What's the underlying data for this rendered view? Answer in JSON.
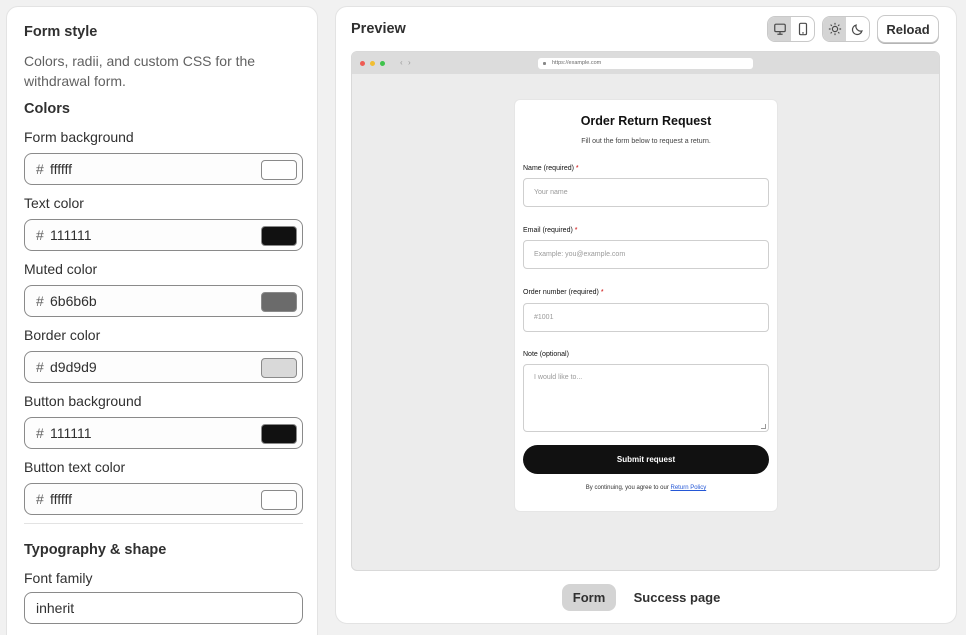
{
  "sidebar": {
    "title": "Form style",
    "description": "Colors, radii, and custom CSS for the withdrawal form.",
    "colors_heading": "Colors",
    "hash": "#",
    "fields": [
      {
        "label": "Form background",
        "value": "ffffff",
        "swatch": "#ffffff"
      },
      {
        "label": "Text color",
        "value": "111111",
        "swatch": "#111111"
      },
      {
        "label": "Muted color",
        "value": "6b6b6b",
        "swatch": "#6b6b6b"
      },
      {
        "label": "Border color",
        "value": "d9d9d9",
        "swatch": "#d9d9d9"
      },
      {
        "label": "Button background",
        "value": "111111",
        "swatch": "#111111"
      },
      {
        "label": "Button text color",
        "value": "ffffff",
        "swatch": "#ffffff"
      }
    ],
    "typography_heading": "Typography & shape",
    "font_family_label": "Font family",
    "font_family_value": "inherit"
  },
  "preview": {
    "title": "Preview",
    "reload_label": "Reload",
    "device_icons": [
      "desktop-icon",
      "mobile-icon"
    ],
    "theme_icons": [
      "sun-icon",
      "moon-icon"
    ],
    "browser": {
      "url": "https://example.com"
    },
    "form": {
      "title": "Order Return Request",
      "subtitle": "Fill out the form below to request a return.",
      "name_label": "Name (required)",
      "name_placeholder": "Your name",
      "email_label": "Email (required)",
      "email_placeholder": "Example: you@example.com",
      "order_label": "Order number (required)",
      "order_placeholder": "#1001",
      "note_label": "Note (optional)",
      "note_placeholder": "I would like to...",
      "required_mark": "*",
      "submit_label": "Submit request",
      "footer_text": "By continuing, you agree to our",
      "footer_link": "Return Policy"
    },
    "tabs": [
      {
        "label": "Form",
        "active": true
      },
      {
        "label": "Success page",
        "active": false
      }
    ]
  }
}
